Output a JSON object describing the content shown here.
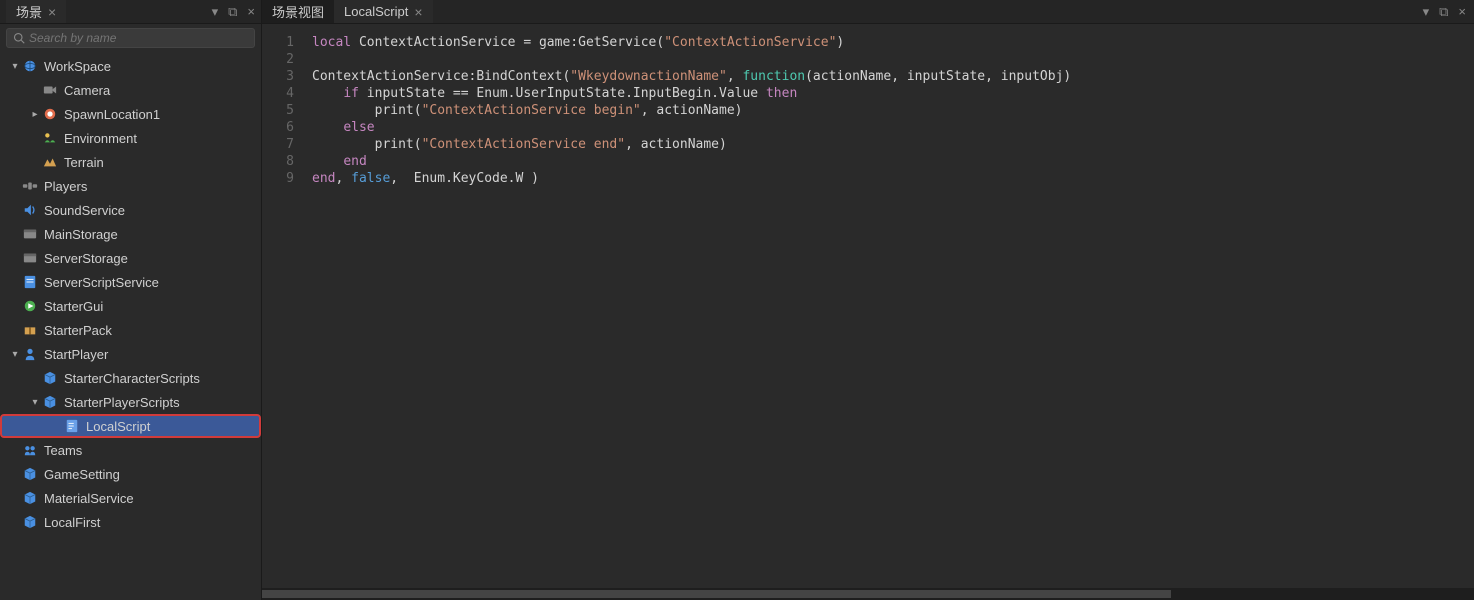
{
  "leftPanel": {
    "tabTitle": "场景",
    "search": {
      "placeholder": "Search by name"
    }
  },
  "tree": {
    "items": [
      {
        "label": "WorkSpace",
        "indent": 0,
        "expanded": true,
        "icon": "globe",
        "color": "#4a90e2"
      },
      {
        "label": "Camera",
        "indent": 1,
        "icon": "camera",
        "color": "#888"
      },
      {
        "label": "SpawnLocation1",
        "indent": 1,
        "expandable": true,
        "icon": "spawn",
        "color": "#e06c4c"
      },
      {
        "label": "Environment",
        "indent": 1,
        "icon": "env",
        "color": "#888"
      },
      {
        "label": "Terrain",
        "indent": 1,
        "icon": "terrain",
        "color": "#d4a050"
      },
      {
        "label": "Players",
        "indent": 0,
        "icon": "players",
        "color": "#888"
      },
      {
        "label": "SoundService",
        "indent": 0,
        "icon": "sound",
        "color": "#4a90e2"
      },
      {
        "label": "MainStorage",
        "indent": 0,
        "icon": "storage",
        "color": "#888"
      },
      {
        "label": "ServerStorage",
        "indent": 0,
        "icon": "storage",
        "color": "#888"
      },
      {
        "label": "ServerScriptService",
        "indent": 0,
        "icon": "script",
        "color": "#4a90e2"
      },
      {
        "label": "StarterGui",
        "indent": 0,
        "icon": "gui",
        "color": "#4caf50"
      },
      {
        "label": "StarterPack",
        "indent": 0,
        "icon": "pack",
        "color": "#d4a050"
      },
      {
        "label": "StartPlayer",
        "indent": 0,
        "expanded": true,
        "icon": "player",
        "color": "#4a90e2"
      },
      {
        "label": "StarterCharacterScripts",
        "indent": 1,
        "icon": "cube",
        "color": "#4a90e2"
      },
      {
        "label": "StarterPlayerScripts",
        "indent": 1,
        "expanded": true,
        "icon": "cube",
        "color": "#4a90e2"
      },
      {
        "label": "LocalScript",
        "indent": 2,
        "icon": "localscript",
        "color": "#6aa0e8",
        "selected": true
      },
      {
        "label": "Teams",
        "indent": 0,
        "icon": "teams",
        "color": "#4a90e2"
      },
      {
        "label": "GameSetting",
        "indent": 0,
        "icon": "cube",
        "color": "#4a90e2"
      },
      {
        "label": "MaterialService",
        "indent": 0,
        "icon": "cube",
        "color": "#4a90e2"
      },
      {
        "label": "LocalFirst",
        "indent": 0,
        "icon": "cube",
        "color": "#4a90e2"
      }
    ]
  },
  "rightPanel": {
    "tabs": [
      {
        "label": "场景视图",
        "closable": false,
        "active": false
      },
      {
        "label": "LocalScript",
        "closable": true,
        "active": true
      }
    ]
  },
  "code": {
    "lines": [
      {
        "n": 1,
        "tokens": [
          [
            "kw",
            "local"
          ],
          [
            "ident",
            " ContextActionService = game:GetService("
          ],
          [
            "str",
            "\"ContextActionService\""
          ],
          [
            "ident",
            ")"
          ]
        ]
      },
      {
        "n": 2,
        "tokens": []
      },
      {
        "n": 3,
        "tokens": [
          [
            "ident",
            "ContextActionService:BindContext("
          ],
          [
            "str",
            "\"WkeydownactionName\""
          ],
          [
            "ident",
            ", "
          ],
          [
            "fn",
            "function"
          ],
          [
            "ident",
            "(actionName, inputState, inputObj)"
          ]
        ]
      },
      {
        "n": 4,
        "tokens": [
          [
            "ident",
            "    "
          ],
          [
            "kw",
            "if"
          ],
          [
            "ident",
            " inputState == Enum.UserInputState.InputBegin.Value "
          ],
          [
            "kw",
            "then"
          ]
        ]
      },
      {
        "n": 5,
        "tokens": [
          [
            "ident",
            "        print("
          ],
          [
            "str",
            "\"ContextActionService begin\""
          ],
          [
            "ident",
            ", actionName)"
          ]
        ]
      },
      {
        "n": 6,
        "tokens": [
          [
            "ident",
            "    "
          ],
          [
            "kw",
            "else"
          ]
        ]
      },
      {
        "n": 7,
        "tokens": [
          [
            "ident",
            "        print("
          ],
          [
            "str",
            "\"ContextActionService end\""
          ],
          [
            "ident",
            ", actionName)"
          ]
        ]
      },
      {
        "n": 8,
        "tokens": [
          [
            "ident",
            "    "
          ],
          [
            "kw",
            "end"
          ]
        ]
      },
      {
        "n": 9,
        "tokens": [
          [
            "kw",
            "end"
          ],
          [
            "ident",
            ", "
          ],
          [
            "bool",
            "false"
          ],
          [
            "ident",
            ",  Enum.KeyCode.W )"
          ]
        ]
      }
    ]
  }
}
